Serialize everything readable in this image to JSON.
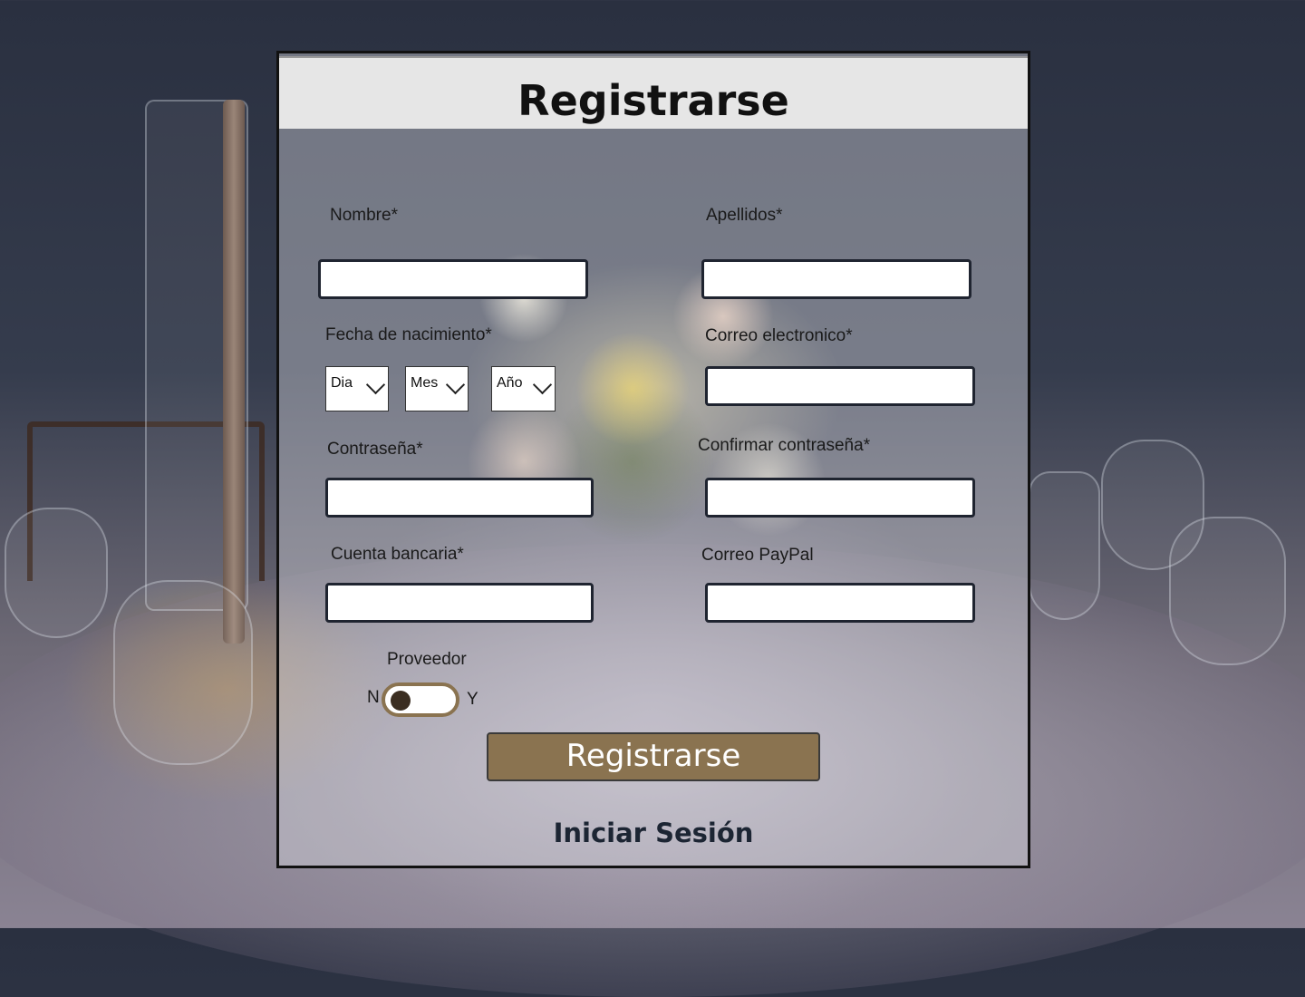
{
  "form": {
    "title": "Registrarse",
    "fields": {
      "nombre": {
        "label": "Nombre*",
        "value": ""
      },
      "apellidos": {
        "label": "Apellidos*",
        "value": ""
      },
      "fecha": {
        "label": "Fecha de nacimiento*"
      },
      "correo": {
        "label": "Correo electronico*",
        "value": ""
      },
      "contrasena": {
        "label": "Contraseña*",
        "value": ""
      },
      "confirmar": {
        "label": "Confirmar contraseña*",
        "value": ""
      },
      "cuenta": {
        "label": "Cuenta bancaria*",
        "value": ""
      },
      "paypal": {
        "label": "Correo PayPal",
        "value": ""
      }
    },
    "date_selects": {
      "day": "Dia",
      "month": "Mes",
      "year": "Año"
    },
    "provider": {
      "label": "Proveedor",
      "off_label": "N",
      "on_label": "Y",
      "enabled": false
    },
    "submit_label": "Registrarse",
    "login_link": "Iniciar Sesión"
  },
  "colors": {
    "accent": "#8a7350",
    "header_bg": "#e6e6e6",
    "field_border": "#1f2430"
  }
}
